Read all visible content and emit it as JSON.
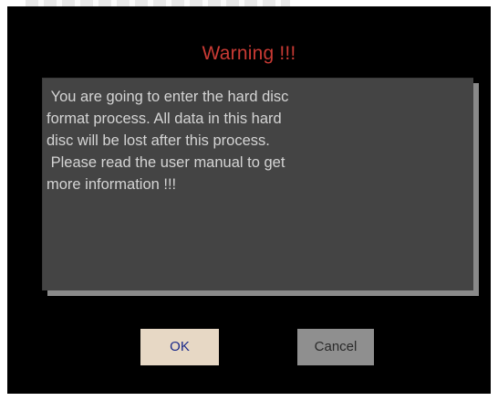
{
  "dialog": {
    "title": "Warning !!!",
    "message": " You are going to enter the hard disc\nformat process. All data in this hard\ndisc will be lost after this process.\n Please read the user manual to get\nmore information !!!",
    "ok_label": "OK",
    "cancel_label": "Cancel"
  },
  "colors": {
    "background": "#000000",
    "title": "#c83a34",
    "message_box": "#444444",
    "ok_button": "#e7d8c5",
    "cancel_button": "#8f8f8f"
  }
}
